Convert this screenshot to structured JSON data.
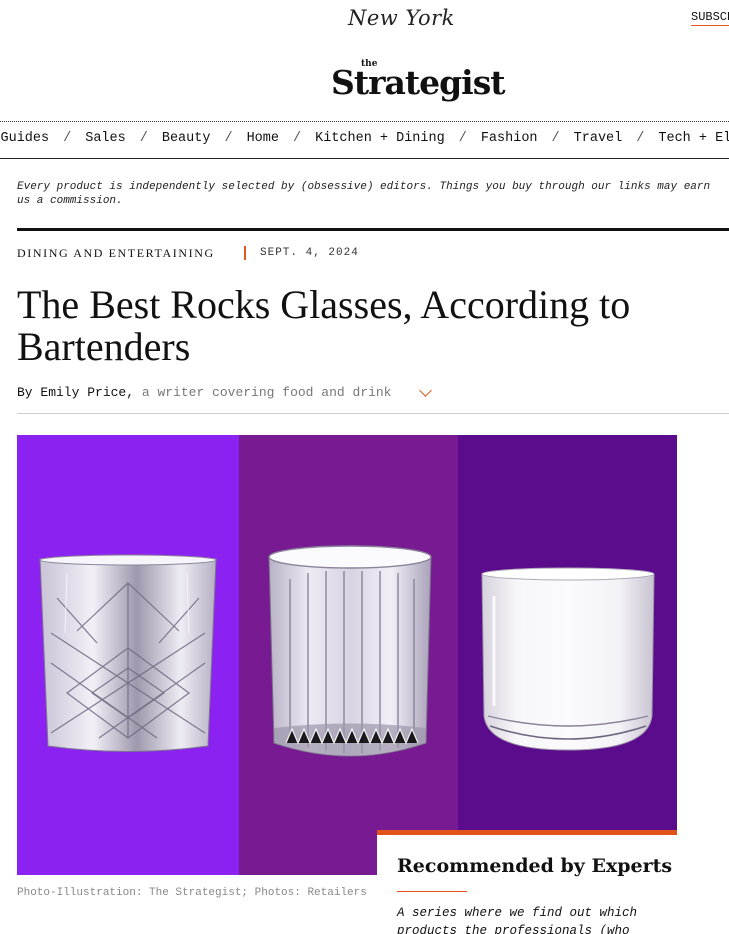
{
  "header": {
    "publication_logo": "New York",
    "subscribe_label": "SUBSCRIBE",
    "site_logo_small": "the",
    "site_logo": "Strategist"
  },
  "nav": {
    "items": [
      "Gift Guides",
      "Sales",
      "Beauty",
      "Home",
      "Kitchen + Dining",
      "Fashion",
      "Travel",
      "Tech + Electronics"
    ],
    "separator": "/"
  },
  "disclosure": "Every product is independently selected by (obsessive) editors. Things you buy through our links may earn us a commission.",
  "article": {
    "rubric": "Dining and Entertaining",
    "date": "SEPT. 4, 2024",
    "headline": "The Best Rocks Glasses, According to Bartenders",
    "byline_prefix": "By ",
    "author": "Emily Price",
    "byline_comma": ", ",
    "author_role": "a writer covering food and drink"
  },
  "hero": {
    "panel_colors": [
      "#8c22f2",
      "#781a92",
      "#5b0c8c"
    ],
    "caption": "Photo-Illustration: The Strategist; Photos: Retailers"
  },
  "recommended_card": {
    "title": "Recommended by Experts",
    "description": "A series where we find out which products the professionals (who",
    "accent_color": "#e2531c"
  }
}
